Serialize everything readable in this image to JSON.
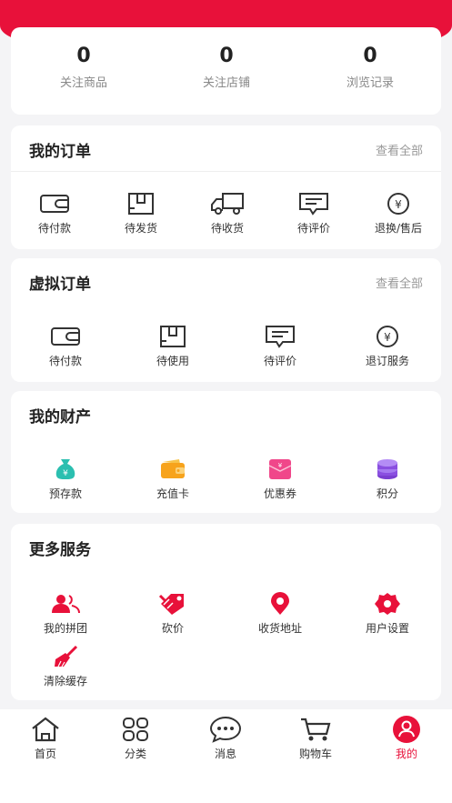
{
  "stats": [
    {
      "value": "0",
      "label": "关注商品"
    },
    {
      "value": "0",
      "label": "关注店铺"
    },
    {
      "value": "0",
      "label": "浏览记录"
    }
  ],
  "orders": {
    "title": "我的订单",
    "more": "查看全部",
    "items": [
      {
        "label": "待付款",
        "icon": "wallet-icon"
      },
      {
        "label": "待发货",
        "icon": "box-icon"
      },
      {
        "label": "待收货",
        "icon": "truck-icon"
      },
      {
        "label": "待评价",
        "icon": "comment-icon"
      },
      {
        "label": "退换/售后",
        "icon": "yen-circle-icon"
      }
    ]
  },
  "virtual_orders": {
    "title": "虚拟订单",
    "more": "查看全部",
    "items": [
      {
        "label": "待付款",
        "icon": "wallet-icon"
      },
      {
        "label": "待使用",
        "icon": "box-icon"
      },
      {
        "label": "待评价",
        "icon": "comment-icon"
      },
      {
        "label": "退订服务",
        "icon": "yen-circle-icon"
      }
    ]
  },
  "assets": {
    "title": "我的财产",
    "items": [
      {
        "label": "预存款",
        "icon": "money-bag-icon"
      },
      {
        "label": "充值卡",
        "icon": "wallet-card-icon"
      },
      {
        "label": "优惠券",
        "icon": "coupon-icon"
      },
      {
        "label": "积分",
        "icon": "coins-stack-icon"
      }
    ]
  },
  "services": {
    "title": "更多服务",
    "items": [
      {
        "label": "我的拼团",
        "icon": "group-icon"
      },
      {
        "label": "砍价",
        "icon": "price-tag-icon"
      },
      {
        "label": "收货地址",
        "icon": "location-pin-icon"
      },
      {
        "label": "用户设置",
        "icon": "settings-gear-icon"
      },
      {
        "label": "清除缓存",
        "icon": "broom-icon"
      }
    ]
  },
  "tabbar": [
    {
      "label": "首页",
      "icon": "home-icon"
    },
    {
      "label": "分类",
      "icon": "category-icon"
    },
    {
      "label": "消息",
      "icon": "message-icon"
    },
    {
      "label": "购物车",
      "icon": "cart-icon"
    },
    {
      "label": "我的",
      "icon": "profile-icon",
      "active": true
    }
  ],
  "colors": {
    "accent": "#e8113a",
    "teal": "#2bbfb0",
    "orange": "#f7a31c",
    "pink": "#f0478a",
    "purple": "#8a4fe0"
  }
}
